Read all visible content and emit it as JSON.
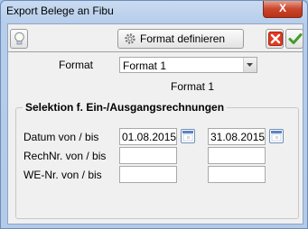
{
  "window": {
    "title": "Export Belege an Fibu",
    "close_label": "X"
  },
  "toolbar": {
    "format_button_label": "Format definieren"
  },
  "format": {
    "label": "Format",
    "selected": "Format 1",
    "display_name": "Format 1"
  },
  "selection": {
    "group_title": "Selektion f. Ein-/Ausgangsrechnungen",
    "date_label": "Datum von / bis",
    "date_from": "01.08.2015",
    "date_to": "31.08.2015",
    "invoice_no_label": "RechNr. von / bis",
    "invoice_no_from": "",
    "invoice_no_to": "",
    "we_no_label": "WE-Nr. von / bis",
    "we_no_from": "",
    "we_no_to": ""
  }
}
